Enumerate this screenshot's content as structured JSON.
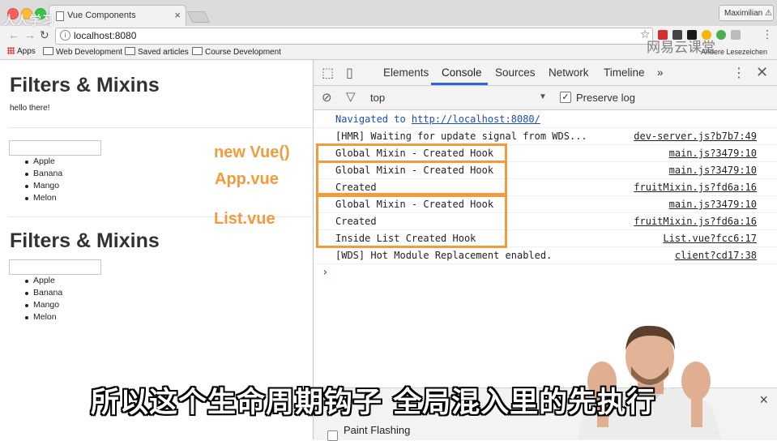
{
  "browser": {
    "tab_title": "Vue Components",
    "tab_close": "×",
    "profile": "Maximilian ⚠",
    "url": "localhost:8080",
    "bookmarks": [
      "Apps",
      "Web Development",
      "Saved articles",
      "Course Development"
    ],
    "other_bookmarks": "Andere Lesezeichen",
    "watermark_left": "人人学习",
    "watermark_right": "网易云课堂"
  },
  "page": {
    "heading_1": "Filters & Mixins",
    "hello_text": "hello there!",
    "list_1": [
      "Apple",
      "Banana",
      "Mango",
      "Melon"
    ],
    "heading_2": "Filters & Mixins",
    "list_2": [
      "Apple",
      "Banana",
      "Mango",
      "Melon"
    ]
  },
  "annotations": {
    "new_vue": "new Vue()",
    "app_vue": "App.vue",
    "list_vue": "List.vue",
    "color": "#f39b3c"
  },
  "devtools": {
    "tabs": [
      "Elements",
      "Console",
      "Sources",
      "Network",
      "Timeline"
    ],
    "active_tab": "Console",
    "more_tabs": "»",
    "context": "top",
    "preserve_log_label": "Preserve log",
    "preserve_log_checked": true,
    "navigated_prefix": "Navigated to ",
    "navigated_url": "http://localhost:8080/",
    "messages": [
      {
        "text": "[HMR] Waiting for update signal from WDS...",
        "source": "dev-server.js?b7b7:49"
      },
      {
        "text": "Global Mixin - Created Hook",
        "source": "main.js?3479:10"
      },
      {
        "text": "Global Mixin - Created Hook",
        "source": "main.js?3479:10"
      },
      {
        "text": "Created",
        "source": "fruitMixin.js?fd6a:16"
      },
      {
        "text": "Global Mixin - Created Hook",
        "source": "main.js?3479:10"
      },
      {
        "text": "Created",
        "source": "fruitMixin.js?fd6a:16"
      },
      {
        "text": "Inside List Created Hook",
        "source": "List.vue?fcc6:17"
      },
      {
        "text": "[WDS] Hot Module Replacement enabled.",
        "source": "client?cd17:38"
      }
    ],
    "prompt": "›",
    "drawer_partial": "Net",
    "drawer_close": "×",
    "paint_flashing": "Paint Flashing",
    "accent": "#2d6ad8"
  },
  "subtitle": "所以这个生命周期钩子 全局混入里的先执行"
}
